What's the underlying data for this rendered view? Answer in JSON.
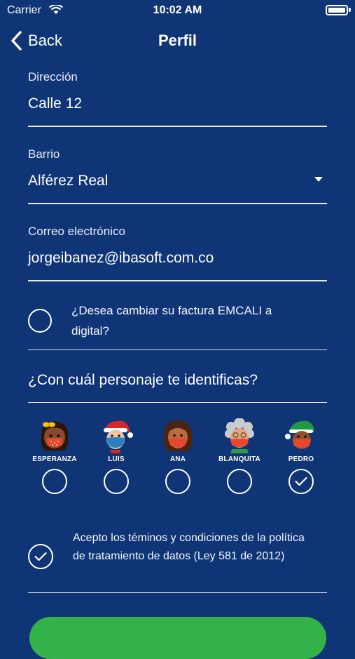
{
  "status_bar": {
    "carrier": "Carrier",
    "time": "10:02 AM"
  },
  "nav": {
    "back_label": "Back",
    "title": "Perfil"
  },
  "form": {
    "direccion": {
      "label": "Dirección",
      "value": "Calle 12"
    },
    "barrio": {
      "label": "Barrio",
      "value": "Alférez Real"
    },
    "correo": {
      "label": "Correo electrónico",
      "value": "jorgeibanez@ibasoft.com.co"
    }
  },
  "digital_invoice": {
    "label": "¿Desea cambiar su factura EMCALI a digital?",
    "checked": false
  },
  "characters": {
    "question": "¿Con cuál personaje te identificas?",
    "items": [
      {
        "name": "ESPERANZA",
        "selected": false
      },
      {
        "name": "LUIS",
        "selected": false
      },
      {
        "name": "ANA",
        "selected": false
      },
      {
        "name": "BLANQUITA",
        "selected": false
      },
      {
        "name": "PEDRO",
        "selected": true
      }
    ]
  },
  "terms": {
    "label": "Acepto los téminos y condiciones de la política de tratamiento de datos (Ley 581 de 2012)",
    "checked": true
  },
  "colors": {
    "background": "#0f3576",
    "accent_green": "#34b24a",
    "mask_red": "#e8472f"
  }
}
